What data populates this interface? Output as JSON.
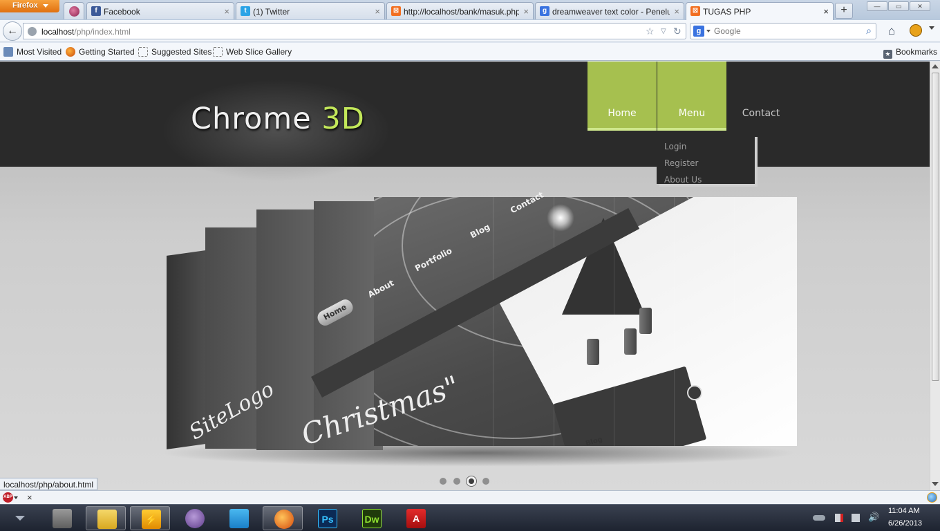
{
  "browser": {
    "menu_button": "Firefox",
    "tabs": [
      {
        "label": "Facebook",
        "favicon": "facebook-icon",
        "color": "#3b5998"
      },
      {
        "label": "(1) Twitter",
        "favicon": "twitter-icon",
        "color": "#2aa3e6"
      },
      {
        "label": "http://localhost/bank/masuk.php",
        "favicon": "xampp-icon",
        "color": "#f26f21"
      },
      {
        "label": "dreamweaver text color - Penelu...",
        "favicon": "google-icon",
        "color": "#3a73e0"
      },
      {
        "label": "TUGAS PHP",
        "favicon": "xampp-icon",
        "color": "#f26f21"
      }
    ],
    "active_tab": "TUGAS PHP",
    "url_host": "localhost",
    "url_path": "/php/index.html",
    "search_engine": "g",
    "search_placeholder": "Google",
    "bookmarks": [
      {
        "label": "Most Visited"
      },
      {
        "label": "Getting Started"
      },
      {
        "label": "Suggested Sites"
      },
      {
        "label": "Web Slice Gallery"
      }
    ],
    "bookmarks_menu": "Bookmarks",
    "status_url": "localhost/php/about.html",
    "addon_abp": "ABP"
  },
  "site": {
    "logo_main": "Chrome ",
    "logo_accent": "3D",
    "nav": [
      {
        "label": "Home"
      },
      {
        "label": "Menu"
      },
      {
        "label": "Contact"
      }
    ],
    "dropdown": [
      {
        "label": "Login"
      },
      {
        "label": "Register"
      },
      {
        "label": "About Us"
      }
    ],
    "slide": {
      "home_button": "Home",
      "links": [
        "About",
        "Portfolio",
        "Blog",
        "Contact"
      ],
      "script_text": "Christmas\"",
      "card_text": "SiteLogo",
      "panel_text": "Blog"
    },
    "pager": {
      "count": 4,
      "current": 3
    }
  },
  "taskbar": {
    "apps": [
      {
        "name": "windows-explorer-icon",
        "glyph": ""
      },
      {
        "name": "windows-icon",
        "glyph": ""
      },
      {
        "name": "winamp-icon",
        "glyph": "⚡"
      },
      {
        "name": "pidgin-icon",
        "glyph": ""
      },
      {
        "name": "twitter-app-icon",
        "glyph": ""
      },
      {
        "name": "firefox-icon",
        "glyph": ""
      },
      {
        "name": "photoshop-icon",
        "glyph": "Ps"
      },
      {
        "name": "dreamweaver-icon",
        "glyph": "Dw"
      },
      {
        "name": "acrobat-icon",
        "glyph": "A"
      }
    ],
    "time": "11:04 AM",
    "date": "6/26/2013"
  }
}
